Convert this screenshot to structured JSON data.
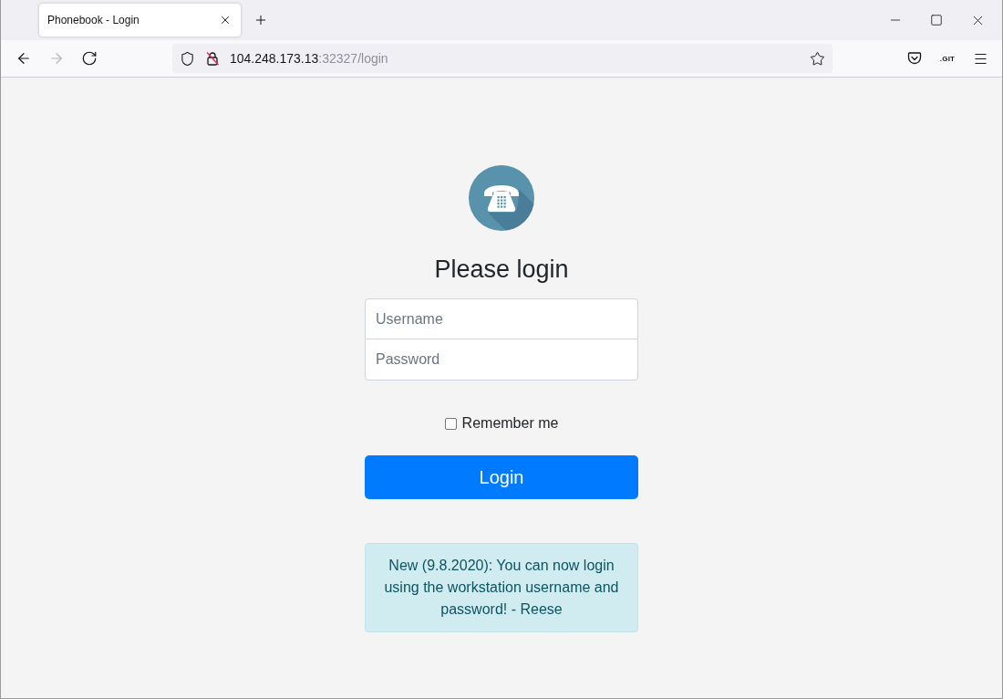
{
  "browser": {
    "tabs": [
      {
        "title": "Phonebook - Login",
        "selected": true
      }
    ],
    "nav_buttons": [
      {
        "kind": "back",
        "disabled": false
      },
      {
        "kind": "forward",
        "disabled": true
      },
      {
        "kind": "reload",
        "disabled": false
      }
    ],
    "address": {
      "host": "104.248.173.13",
      "rest": ":32327/login"
    },
    "extension_label": ".GIT"
  },
  "page": {
    "heading": "Please login",
    "fields": [
      {
        "placeholder": "Username"
      },
      {
        "placeholder": "Password"
      }
    ],
    "remember": {
      "label": "Remember me",
      "checked": false
    },
    "submit": "Login",
    "notice": "New (9.8.2020): You can now login using the workstation username and password! - Reese"
  }
}
